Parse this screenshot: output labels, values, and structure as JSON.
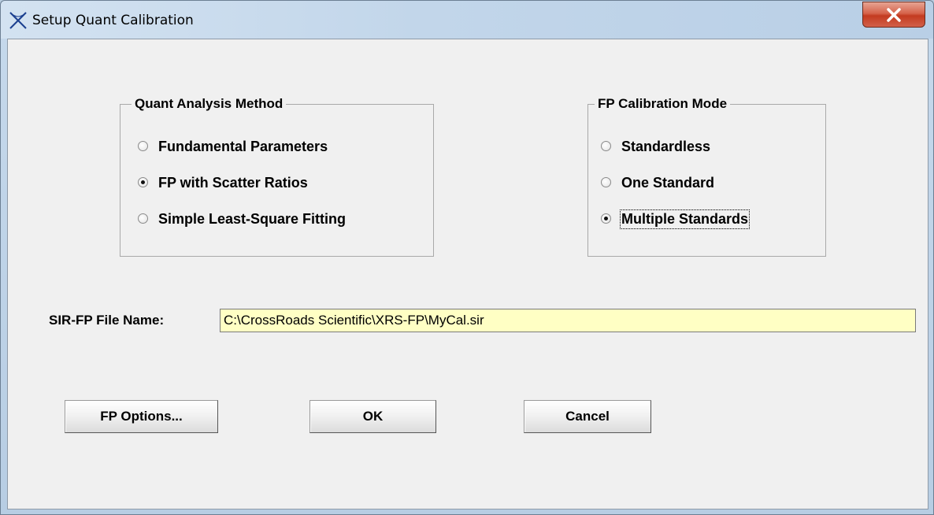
{
  "window": {
    "title": "Setup Quant Calibration",
    "icon": "crossroads-x-icon",
    "close_glyph": "X"
  },
  "quant_method": {
    "label": "Quant Analysis Method",
    "options": [
      {
        "label": "Fundamental Parameters",
        "checked": false
      },
      {
        "label": "FP with Scatter Ratios",
        "checked": true
      },
      {
        "label": "Simple Least-Square Fitting",
        "checked": false
      }
    ]
  },
  "calibration_mode": {
    "label": "FP Calibration Mode",
    "options": [
      {
        "label": "Standardless",
        "checked": false
      },
      {
        "label": "One Standard",
        "checked": false
      },
      {
        "label": "Multiple Standards",
        "checked": true
      }
    ]
  },
  "file": {
    "label": "SIR-FP File Name:",
    "value": "C:\\CrossRoads Scientific\\XRS-FP\\MyCal.sir"
  },
  "buttons": {
    "fp_options": "FP Options...",
    "ok": "OK",
    "cancel": "Cancel"
  },
  "colors": {
    "input_background": "#ffffc4",
    "dialog_background": "#f0f0f0",
    "close_button": "#c33b20"
  }
}
